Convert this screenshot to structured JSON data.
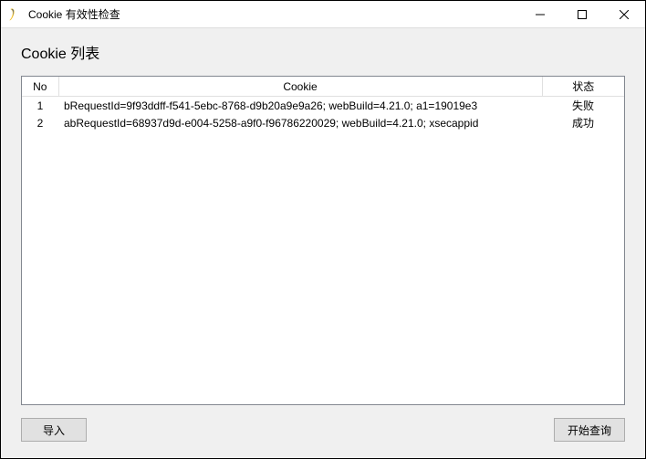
{
  "window": {
    "title": "Cookie 有效性检查"
  },
  "heading": "Cookie 列表",
  "table": {
    "headers": {
      "no": "No",
      "cookie": "Cookie",
      "status": "状态"
    },
    "rows": [
      {
        "no": "1",
        "cookie": "bRequestId=9f93ddff-f541-5ebc-8768-d9b20a9e9a26; webBuild=4.21.0; a1=19019e3",
        "status": "失败"
      },
      {
        "no": "2",
        "cookie": "abRequestId=68937d9d-e004-5258-a9f0-f96786220029; webBuild=4.21.0; xsecappid",
        "status": "成功"
      }
    ]
  },
  "buttons": {
    "import": "导入",
    "query": "开始查询"
  }
}
